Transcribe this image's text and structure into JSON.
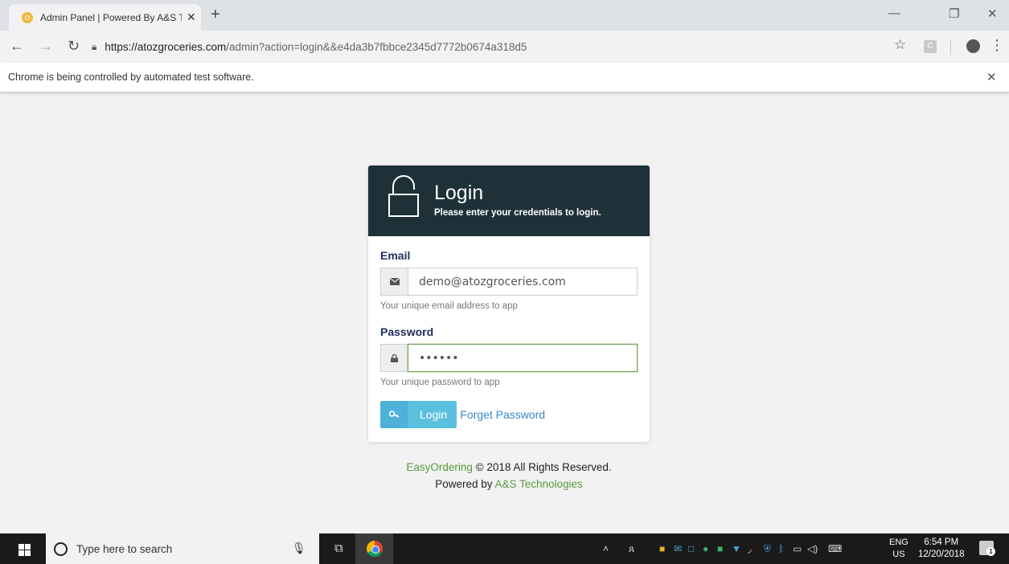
{
  "browser": {
    "tab_title": "Admin Panel | Powered By A&S T",
    "tab_close": "✕",
    "new_tab": "+",
    "url_host": "https://atozgroceries.com",
    "url_path": "/admin?action=login&&e4da3b7fbbce2345d7772b0674a318d5",
    "extension_label": "C",
    "info_message": "Chrome is being controlled by automated test software.",
    "info_close": "✕",
    "window_minimize": "—",
    "window_maximize": "❐",
    "window_close": "✕"
  },
  "login": {
    "title": "Login",
    "subtitle": "Please enter your credentials to login.",
    "email_label": "Email",
    "email_value": "demo@atozgroceries.com",
    "email_help": "Your unique email address to app",
    "password_label": "Password",
    "password_value": "••••••",
    "password_help": "Your unique password to app",
    "login_button": "Login",
    "forgot_link": "Forget Password"
  },
  "footer": {
    "brand": "EasyOrdering",
    "copyright": " © 2018 All Rights Reserved.",
    "powered_prefix": "Powered by ",
    "powered_company": "A&S Technologies"
  },
  "taskbar": {
    "search_placeholder": "Type here to search",
    "language_top": "ENG",
    "language_bottom": "US",
    "time": "6:54 PM",
    "date": "12/20/2018",
    "notification_count": "1"
  },
  "colors": {
    "header_bg": "#1e3138",
    "label_color": "#1f2d5a",
    "button_bg": "#5bc0de",
    "link_color": "#3a86c6",
    "brand_green": "#5a9a3c"
  }
}
